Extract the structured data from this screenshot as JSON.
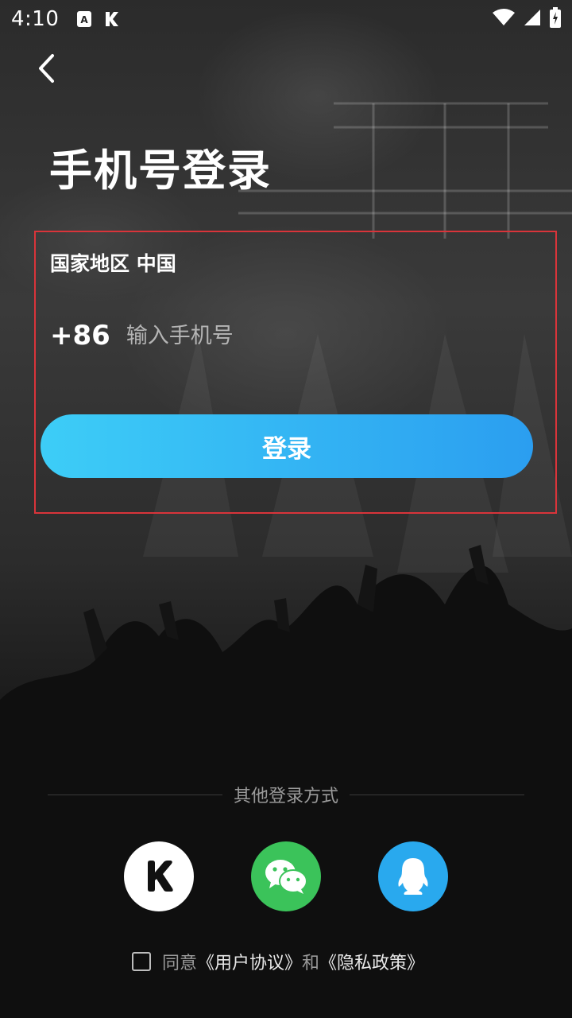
{
  "status_bar": {
    "time": "4:10"
  },
  "title": "手机号登录",
  "form": {
    "region_label": "国家地区",
    "region_value": "中国",
    "country_code": "+86",
    "phone_placeholder": "输入手机号",
    "phone_value": "",
    "login_button": "登录"
  },
  "other_login": {
    "label": "其他登录方式",
    "methods": [
      {
        "name": "k-icon",
        "color": "#ffffff"
      },
      {
        "name": "wechat-icon",
        "color": "#3bc35a"
      },
      {
        "name": "qq-icon",
        "color": "#29a9ee"
      }
    ]
  },
  "agreement": {
    "checked": false,
    "prefix": "同意",
    "user_agreement": "《用户协议》",
    "and": "和",
    "privacy_policy": "《隐私政策》"
  },
  "colors": {
    "login_button_start": "#3dcdf7",
    "login_button_end": "#2b9ef0",
    "highlight_border": "#d9343a"
  }
}
